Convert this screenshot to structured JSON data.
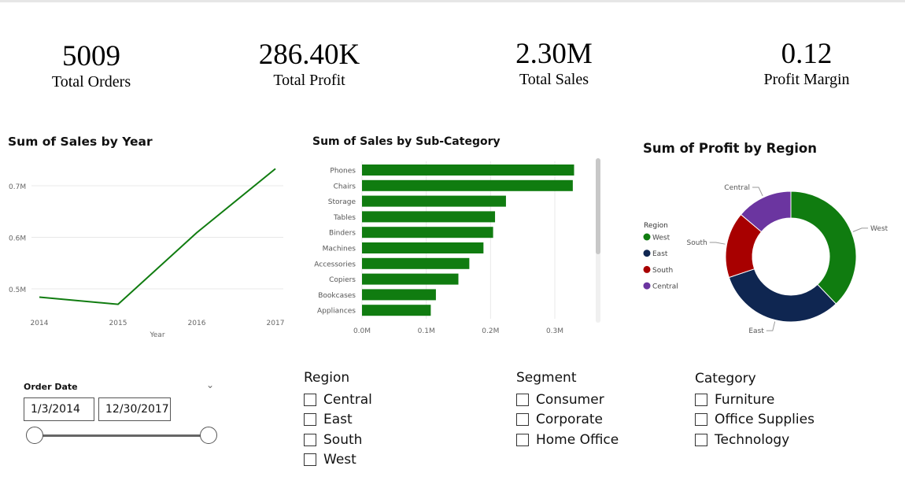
{
  "kpis": [
    {
      "value": "5009",
      "label": "Total Orders"
    },
    {
      "value": "286.40K",
      "label": "Total Profit"
    },
    {
      "value": "2.30M",
      "label": "Total Sales"
    },
    {
      "value": "0.12",
      "label": "Profit Margin"
    }
  ],
  "colors": {
    "green": "#107c10",
    "navy": "#12239e",
    "east": "#0f2651",
    "south": "#a80000",
    "central": "#6b35a0",
    "grid": "#e8e8e8"
  },
  "chart_data": [
    {
      "type": "line",
      "title": "Sum of Sales by Year",
      "xlabel": "Year",
      "ylabel": "",
      "x": [
        "2014",
        "2015",
        "2016",
        "2017"
      ],
      "series": [
        {
          "values": [
            0.484,
            0.47,
            0.609,
            0.733
          ]
        }
      ],
      "yticks": [
        "0.5M",
        "0.6M",
        "0.7M"
      ],
      "ylim": [
        0.4,
        0.8
      ],
      "grid": true
    },
    {
      "type": "bar",
      "orientation": "horizontal",
      "title": "Sum of Sales by Sub-Category",
      "categories": [
        "Phones",
        "Chairs",
        "Storage",
        "Tables",
        "Binders",
        "Machines",
        "Accessories",
        "Copiers",
        "Bookcases",
        "Appliances"
      ],
      "values": [
        0.33,
        0.328,
        0.224,
        0.207,
        0.204,
        0.189,
        0.167,
        0.15,
        0.115,
        0.107
      ],
      "xticks": [
        "0.0M",
        "0.1M",
        "0.2M",
        "0.3M"
      ],
      "xlim": [
        0,
        0.3
      ],
      "grid": true
    },
    {
      "type": "pie",
      "donut": true,
      "title": "Sum of Profit by Region",
      "legend_title": "Region",
      "legend_position": "left",
      "labels": [
        "West",
        "East",
        "South",
        "Central"
      ],
      "values": [
        108.4,
        91.5,
        46.7,
        39.7
      ]
    }
  ],
  "order_date": {
    "title": "Order Date",
    "start": "1/3/2014",
    "end": "12/30/2017",
    "chevron": "⌄"
  },
  "slicers": [
    {
      "title": "Region",
      "items": [
        "Central",
        "East",
        "South",
        "West"
      ]
    },
    {
      "title": "Segment",
      "items": [
        "Consumer",
        "Corporate",
        "Home Office"
      ]
    },
    {
      "title": "Category",
      "items": [
        "Furniture",
        "Office Supplies",
        "Technology"
      ]
    }
  ]
}
